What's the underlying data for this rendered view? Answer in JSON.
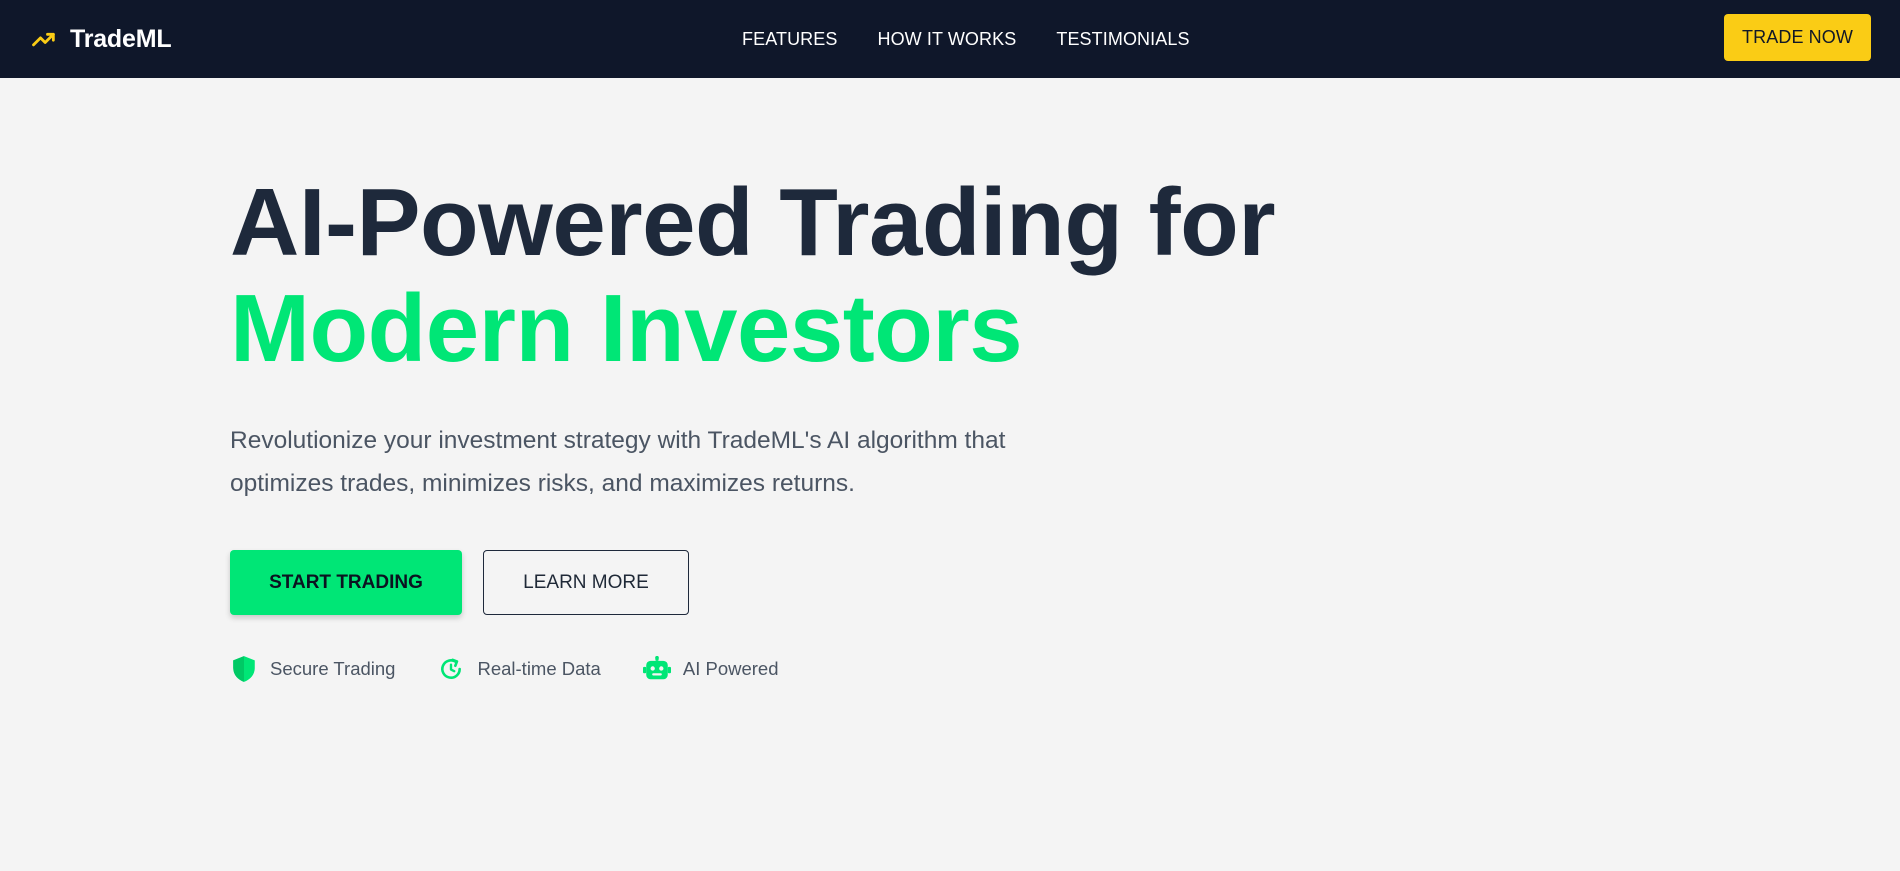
{
  "brand": {
    "icon": "trending-up-icon",
    "name": "TradeML",
    "icon_color": "#facc15"
  },
  "nav": {
    "links": [
      {
        "label": "FEATURES"
      },
      {
        "label": "HOW IT WORKS"
      },
      {
        "label": "TESTIMONIALS"
      }
    ],
    "cta_label": "TRADE NOW"
  },
  "hero": {
    "headline_line1": "AI-Powered Trading for",
    "headline_line2": "Modern Investors",
    "subtext": "Revolutionize your investment strategy with TradeML's AI algorithm that optimizes trades, minimizes risks, and maximizes returns.",
    "primary_button": "START TRADING",
    "secondary_button": "LEARN MORE",
    "features": [
      {
        "icon": "shield-icon",
        "label": "Secure Trading"
      },
      {
        "icon": "refresh-clock-icon",
        "label": "Real-time Data"
      },
      {
        "icon": "robot-icon",
        "label": "AI Powered"
      }
    ]
  },
  "colors": {
    "navbar_bg": "#0f172a",
    "accent_green": "#00e676",
    "accent_yellow": "#facc15",
    "page_bg": "#f4f4f4",
    "heading_dark": "#1e293b"
  }
}
